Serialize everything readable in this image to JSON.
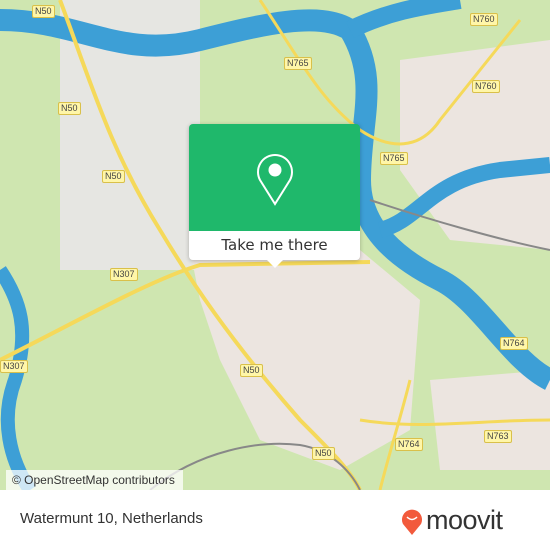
{
  "map": {
    "road_labels": [
      "N50",
      "N765",
      "N760",
      "N50",
      "N50",
      "N765",
      "N760",
      "N307",
      "N307",
      "N50",
      "N764",
      "N764",
      "N763",
      "N50"
    ],
    "attribution": "© OpenStreetMap contributors",
    "colors": {
      "land": "#cfe6b0",
      "water": "#3d9fd6",
      "urban": "#ece5e0",
      "road": "#f5d95a",
      "popup": "#1fb86b"
    }
  },
  "popup": {
    "icon": "map-pin-icon",
    "action_label": "Take me there"
  },
  "footer": {
    "address": "Watermunt 10, Netherlands",
    "brand": "moovit",
    "brand_color": "#f25a3c"
  }
}
